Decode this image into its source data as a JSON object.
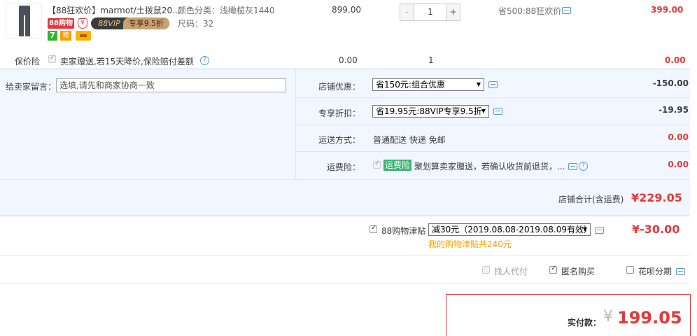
{
  "item": {
    "title": "【88狂欢价】marmot/土拨鼠20...",
    "badge_88": "88购物",
    "shield_icon": "¥",
    "vip_left": "88VIP",
    "vip_right": "专享9.5折",
    "badge_7": "7",
    "gift_icon": "赠",
    "attr_color": "颜色分类：浅橄榄灰1440",
    "attr_size": "尺码：32",
    "price": "899.00",
    "quantity": "1",
    "qty_minus": "-",
    "qty_plus": "+",
    "promotion": "省500:88狂欢价",
    "subtotal": "399.00"
  },
  "insurance": {
    "label": "保价险",
    "text": "卖家赠送,若15天降价,保险赔付差额",
    "price": "0.00",
    "quantity": "1",
    "subtotal": "0.00",
    "help": "?"
  },
  "order": {
    "message_label": "给卖家留言：",
    "message_placeholder": "选填,请先和商家协商一致",
    "store_discount_label": "店铺优惠：",
    "store_discount_value": "省150元:组合优惠",
    "store_discount_amount": "-150.00",
    "vip_discount_label": "专享折扣：",
    "vip_discount_value": "省19.95元:88VIP专享9.5折",
    "vip_discount_amount": "-19.95",
    "shipping_label": "运送方式：",
    "shipping_value": "普通配送 快递 免邮",
    "shipping_amount": "0.00",
    "freight_ins_label": "运费险：",
    "freight_ins_tag": "运费险",
    "freight_ins_text": "聚划算卖家赠送，若确认收货前退货，...",
    "freight_ins_amount": "0.00",
    "total_label": "店铺合计(含运费)",
    "total_value": "¥229.05"
  },
  "jintie": {
    "label": "88购物津贴",
    "selected": "减30元（2019.08.08-2019.08.09有效）",
    "note": "我的购物津贴共240元",
    "amount": "¥-30.00"
  },
  "options": {
    "proxy_pay": "找人代付",
    "anonymous": "匿名购买",
    "huabei": "花呗分期"
  },
  "payment": {
    "label": "实付款：",
    "currency": "¥",
    "amount": "199.05"
  },
  "colors": {
    "accent": "#e4393c",
    "panel_bg": "#f2f7ff",
    "panel_border": "#b2d1ff",
    "warning": "#f4a100"
  }
}
